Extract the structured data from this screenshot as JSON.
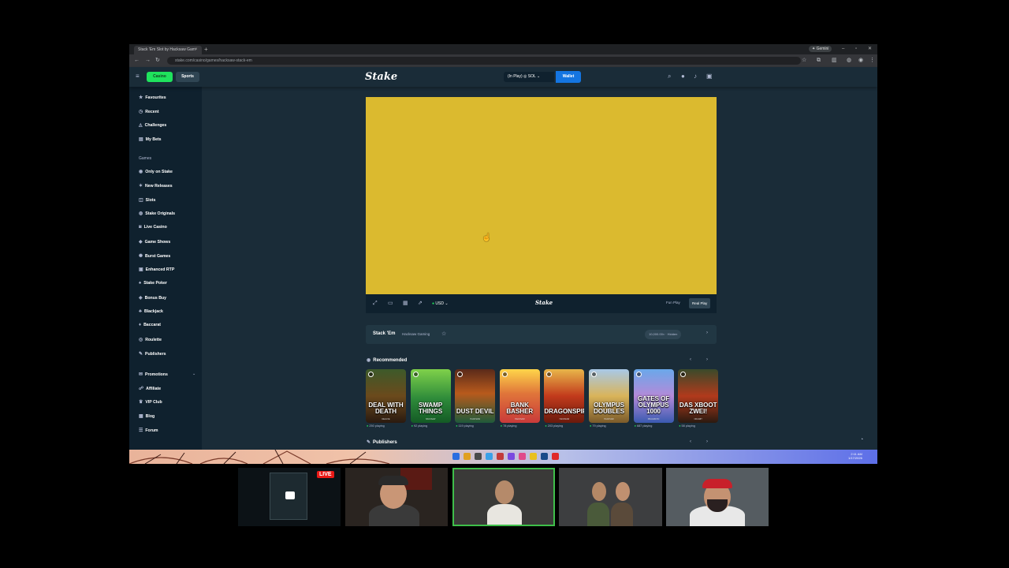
{
  "browser": {
    "tab_title": "Stack 'Em Slot by Hacksaw Gam",
    "tab_close": "×",
    "new_tab": "+",
    "gemini_label": "✦ Gemini",
    "url": "stake.com/casino/games/hacksaw-stack-em"
  },
  "header": {
    "casino_label": "Casino",
    "sports_label": "Sports",
    "logo": "Stake",
    "balance_label": "(In Play) ◎ SOL ⌄",
    "wallet_label": "Wallet"
  },
  "sidebar": {
    "items_top": [
      {
        "icon": "★",
        "label": "Favourites"
      },
      {
        "icon": "◷",
        "label": "Recent"
      },
      {
        "icon": "◬",
        "label": "Challenges"
      },
      {
        "icon": "▤",
        "label": "My Bets"
      }
    ],
    "games_label": "Games",
    "items_games": [
      {
        "icon": "◉",
        "label": "Only on Stake"
      },
      {
        "icon": "✶",
        "label": "New Releases"
      },
      {
        "icon": "◫",
        "label": "Slots"
      },
      {
        "icon": "◍",
        "label": "Stake Originals"
      },
      {
        "icon": "◙",
        "label": "Live Casino"
      },
      {
        "icon": "◆",
        "label": "Game Shows"
      },
      {
        "icon": "✺",
        "label": "Burst Games"
      },
      {
        "icon": "▣",
        "label": "Enhanced RTP"
      },
      {
        "icon": "♠",
        "label": "Stake Poker"
      },
      {
        "icon": "◈",
        "label": "Bonus Buy"
      },
      {
        "icon": "♣",
        "label": "Blackjack"
      },
      {
        "icon": "♦",
        "label": "Baccarat"
      },
      {
        "icon": "◎",
        "label": "Roulette"
      },
      {
        "icon": "✎",
        "label": "Publishers"
      }
    ],
    "items_bottom": [
      {
        "icon": "✉",
        "label": "Promotions"
      },
      {
        "icon": "☍",
        "label": "Affiliate"
      },
      {
        "icon": "♛",
        "label": "VIP Club"
      },
      {
        "icon": "▦",
        "label": "Blog"
      },
      {
        "icon": "☰",
        "label": "Forum"
      }
    ]
  },
  "game": {
    "usd_label": "USD ⌄",
    "toolbar_logo": "Stake",
    "fun_play": "Fun Play",
    "real_play": "Real Play",
    "title": "Stack 'Em",
    "provider": "Hacksaw Gaming",
    "max_win": "10,000.00× · Hidden"
  },
  "recommended": {
    "heading": "Recommended",
    "cards": [
      {
        "title": "DEAL WITH DEATH",
        "sub": "DELUXE",
        "playing": "250 playing",
        "bg": "linear-gradient(180deg,#3d5a2a 0%,#6b4a1c 50%,#2a1a10 100%)"
      },
      {
        "title": "SWAMP THINGS",
        "sub": "HACKSAW",
        "playing": "92 playing",
        "bg": "linear-gradient(180deg,#7fd14a 0%,#2e8b3a 55%,#145a25 100%)"
      },
      {
        "title": "DUST DEVIL",
        "sub": "HACKSAW",
        "playing": "119 playing",
        "bg": "linear-gradient(180deg,#5a2a1a 0%,#b85a1c 45%,#1f5a3a 100%)"
      },
      {
        "title": "BANK BASHER",
        "sub": "HACKSAW",
        "playing": "78 playing",
        "bg": "linear-gradient(180deg,#ffd54a 0%,#e0763a 45%,#c93a3a 100%)"
      },
      {
        "title": "DRAGONSPIRE",
        "sub": "HACKSAW",
        "playing": "203 playing",
        "bg": "linear-gradient(180deg,#e8b64a 0%,#c23a1c 50%,#6a1a0c 100%)"
      },
      {
        "title": "OLYMPUS DOUBLES",
        "sub": "HACKSAW",
        "playing": "79 playing",
        "bg": "linear-gradient(180deg,#a8c9e8 0%,#d9b45a 50%,#7a5a2a 100%)"
      },
      {
        "title": "GATES OF OLYMPUS 1000",
        "sub": "PRAGMATIC",
        "playing": "687 playing",
        "bg": "linear-gradient(180deg,#6aa8ea 0%,#b48ad9 50%,#3a5ab0 100%)"
      },
      {
        "title": "DAS XBOOT ZWEI!",
        "sub": "NOLIMIT",
        "playing": "58 playing",
        "bg": "linear-gradient(180deg,#3a4a2a 0%,#b13a1c 50%,#2a1a10 100%)"
      }
    ]
  },
  "publishers_heading": "Publishers",
  "taskbar": {
    "clock_time": "2:11 AM",
    "clock_date": "1/17/2026"
  },
  "stream": {
    "live_label": "LIVE"
  },
  "colors": {
    "accent_green": "#1fe35d",
    "wallet_blue": "#1475e1",
    "game_yellow": "#dbba2f",
    "bg_main": "#1a2c38",
    "bg_sidebar": "#0f212e"
  }
}
